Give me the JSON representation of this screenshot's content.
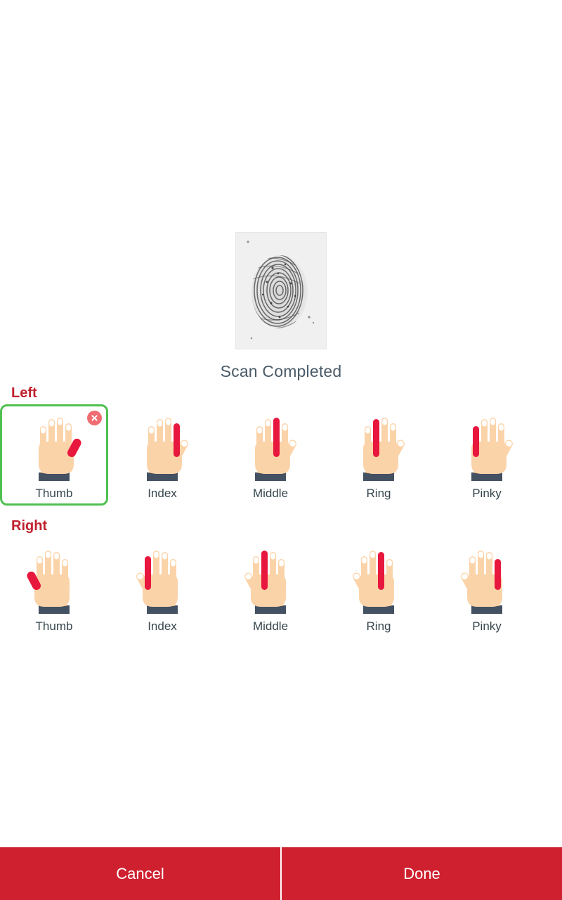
{
  "scan": {
    "status_text": "Scan Completed",
    "image_name": "fingerprint-scan-preview"
  },
  "sections": [
    {
      "id": "left",
      "label": "Left",
      "fingers": [
        {
          "label": "Thumb",
          "selected": true,
          "has_close": true
        },
        {
          "label": "Index",
          "selected": false,
          "has_close": false
        },
        {
          "label": "Middle",
          "selected": false,
          "has_close": false
        },
        {
          "label": "Ring",
          "selected": false,
          "has_close": false
        },
        {
          "label": "Pinky",
          "selected": false,
          "has_close": false
        }
      ]
    },
    {
      "id": "right",
      "label": "Right",
      "fingers": [
        {
          "label": "Thumb",
          "selected": false,
          "has_close": false
        },
        {
          "label": "Index",
          "selected": false,
          "has_close": false
        },
        {
          "label": "Middle",
          "selected": false,
          "has_close": false
        },
        {
          "label": "Ring",
          "selected": false,
          "has_close": false
        },
        {
          "label": "Pinky",
          "selected": false,
          "has_close": false
        }
      ]
    }
  ],
  "actions": {
    "cancel_label": "Cancel",
    "done_label": "Done"
  },
  "colors": {
    "accent_red": "#ce202f",
    "section_label_red": "#c0202e",
    "selected_green": "#4fc04f",
    "finger_highlight": "#e8173d",
    "skin": "#fbd3a8",
    "skin_shadow": "#f6c08a",
    "nail": "#ffffff",
    "cuff": "#445162",
    "cuff_band": "#f0a868",
    "label_text": "#37474f",
    "status_text": "#4a5b68"
  }
}
